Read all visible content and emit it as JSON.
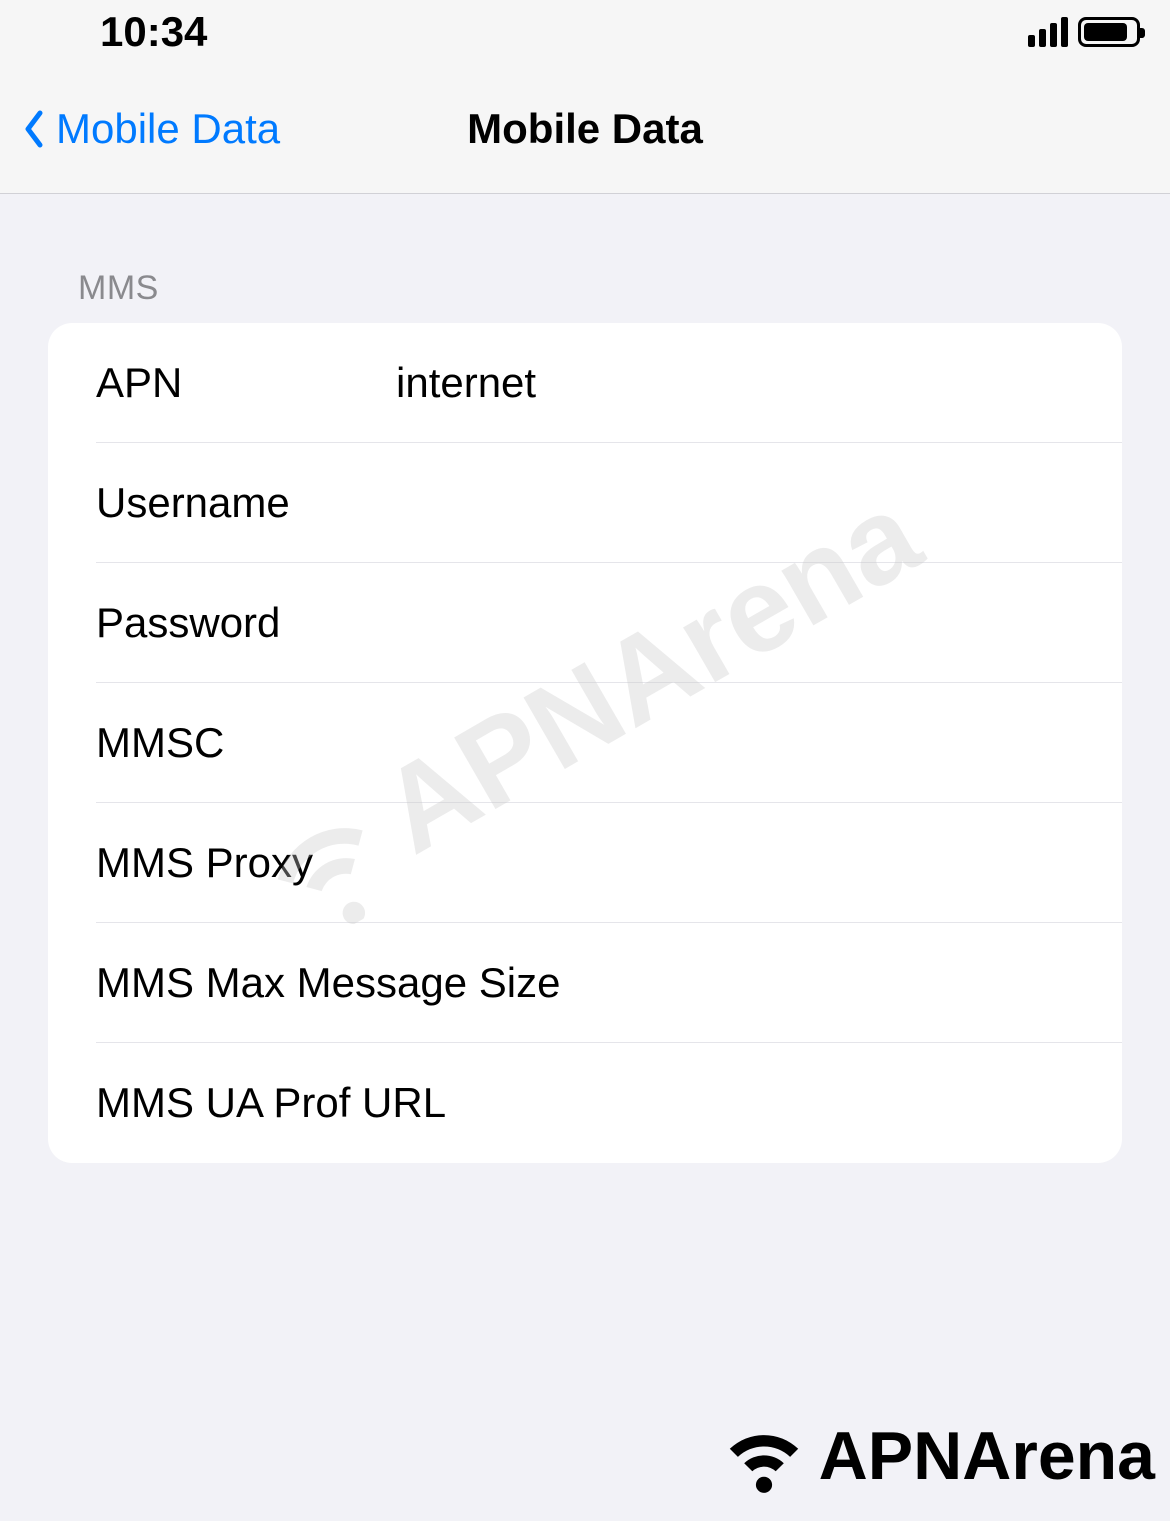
{
  "status_bar": {
    "time": "10:34"
  },
  "nav": {
    "back_label": "Mobile Data",
    "title": "Mobile Data"
  },
  "section": {
    "header": "MMS"
  },
  "fields": {
    "apn": {
      "label": "APN",
      "value": "internet"
    },
    "username": {
      "label": "Username",
      "value": ""
    },
    "password": {
      "label": "Password",
      "value": ""
    },
    "mmsc": {
      "label": "MMSC",
      "value": ""
    },
    "mms_proxy": {
      "label": "MMS Proxy",
      "value": ""
    },
    "mms_max": {
      "label": "MMS Max Message Size",
      "value": ""
    },
    "mms_ua": {
      "label": "MMS UA Prof URL",
      "value": ""
    }
  },
  "watermark": "APNArena",
  "footer_logo": "APNArena"
}
